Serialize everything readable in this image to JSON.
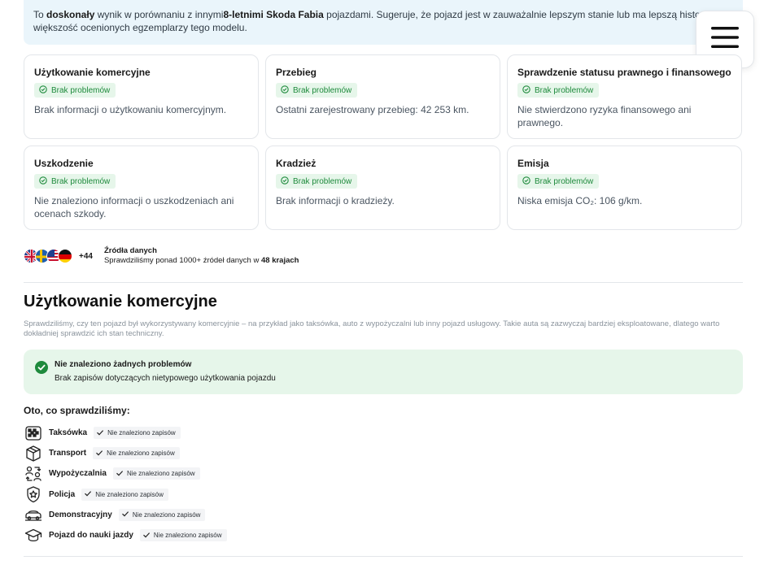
{
  "banner": {
    "t1": "To ",
    "t2": "doskonały",
    "t3": " wynik w porównaniu z innymi",
    "t4": "8-letnimi Skoda Fabia",
    "t5": " pojazdami. Sugeruje, że pojazd jest w zauważalnie lepszym stanie lub ma lepszą historię n",
    "t6": "większość ocenionych egzemplarzy tego modelu."
  },
  "menu": {
    "icon": "hamburger-menu-icon"
  },
  "cards": [
    {
      "title": "Użytkowanie komercyjne",
      "badge": "Brak problemów",
      "text": "Brak informacji o użytkowaniu komercyjnym."
    },
    {
      "title": "Przebieg",
      "badge": "Brak problemów",
      "text": "Ostatni zarejestrowany przebieg: 42 253 km."
    },
    {
      "title": "Sprawdzenie statusu prawnego i finansowego",
      "badge": "Brak problemów",
      "text": "Nie stwierdzono ryzyka finansowego ani prawnego."
    },
    {
      "title": "Uszkodzenie",
      "badge": "Brak problemów",
      "text": "Nie znaleziono informacji o uszkodzeniach ani ocenach szkody."
    },
    {
      "title": "Kradzież",
      "badge": "Brak problemów",
      "text": "Brak informacji o kradzieży."
    },
    {
      "title": "Emisja",
      "badge": "Brak problemów",
      "text": "Niska emisja CO₂: 106 g/km."
    }
  ],
  "sources": {
    "flags": [
      "uk-flag",
      "sweden-flag",
      "usa-flag",
      "germany-flag"
    ],
    "more": "+44",
    "title": "Źródła danych",
    "desc_pre": "Sprawdziliśmy ponad 1000+ źródeł danych w ",
    "desc_bold": "48 krajach"
  },
  "section": {
    "title": "Użytkowanie komercyjne",
    "description": "Sprawdziliśmy, czy ten pojazd był wykorzystywany komercyjnie – na przykład jako taksówka, auto z wypożyczalni lub inny pojazd usługowy. Takie auta są zazwyczaj bardziej eksploatowane, dlatego warto dokładniej sprawdzić ich stan techniczny."
  },
  "ok_box": {
    "title": "Nie znaleziono żadnych problemów",
    "subtitle": "Brak zapisów dotyczących nietypowego użytkowania pojazdu"
  },
  "checked": {
    "heading": "Oto, co sprawdziliśmy:",
    "items": [
      {
        "label": "Taksówka",
        "status": "Nie znaleziono zapisów",
        "icon": "taxi-icon"
      },
      {
        "label": "Transport",
        "status": "Nie znaleziono zapisów",
        "icon": "box-icon"
      },
      {
        "label": "Wypożyczalnia",
        "status": "Nie znaleziono zapisów",
        "icon": "rental-exchange-icon"
      },
      {
        "label": "Policja",
        "status": "Nie znaleziono zapisów",
        "icon": "police-badge-icon"
      },
      {
        "label": "Demonstracyjny",
        "status": "Nie znaleziono zapisów",
        "icon": "demo-car-icon"
      },
      {
        "label": "Pojazd do nauki jazdy",
        "status": "Nie znaleziono zapisów",
        "icon": "graduation-cap-icon"
      }
    ]
  },
  "colors": {
    "success": "#1e8a3c",
    "success_bg": "#e6f6ea",
    "banner_bg": "#eaf5fb"
  }
}
